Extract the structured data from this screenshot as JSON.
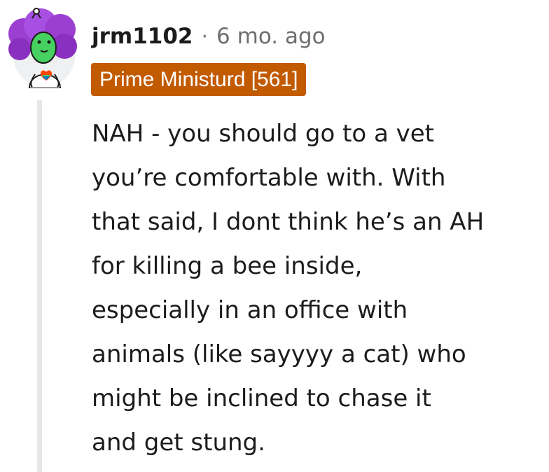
{
  "comment": {
    "username": "jrm1102",
    "separator": "·",
    "timestamp": "6 mo. ago",
    "flair": "Prime Ministurd [561]",
    "body_lines": [
      "NAH - you should go to a vet",
      "you’re comfortable with. With",
      "that said, I dont think he’s an AH",
      "for killing a bee inside,",
      "especially in an office with",
      "animals (like sayyyy a cat) who",
      "might be inclined to chase it",
      "and get stung."
    ]
  },
  "colors": {
    "flair_background": "#c25a00",
    "thread_line": "#e5e7e9",
    "avatar_hair": "#9b3fd0",
    "avatar_face": "#46d160"
  },
  "icons": {
    "avatar": "snoo-avatar-purple-hair"
  }
}
